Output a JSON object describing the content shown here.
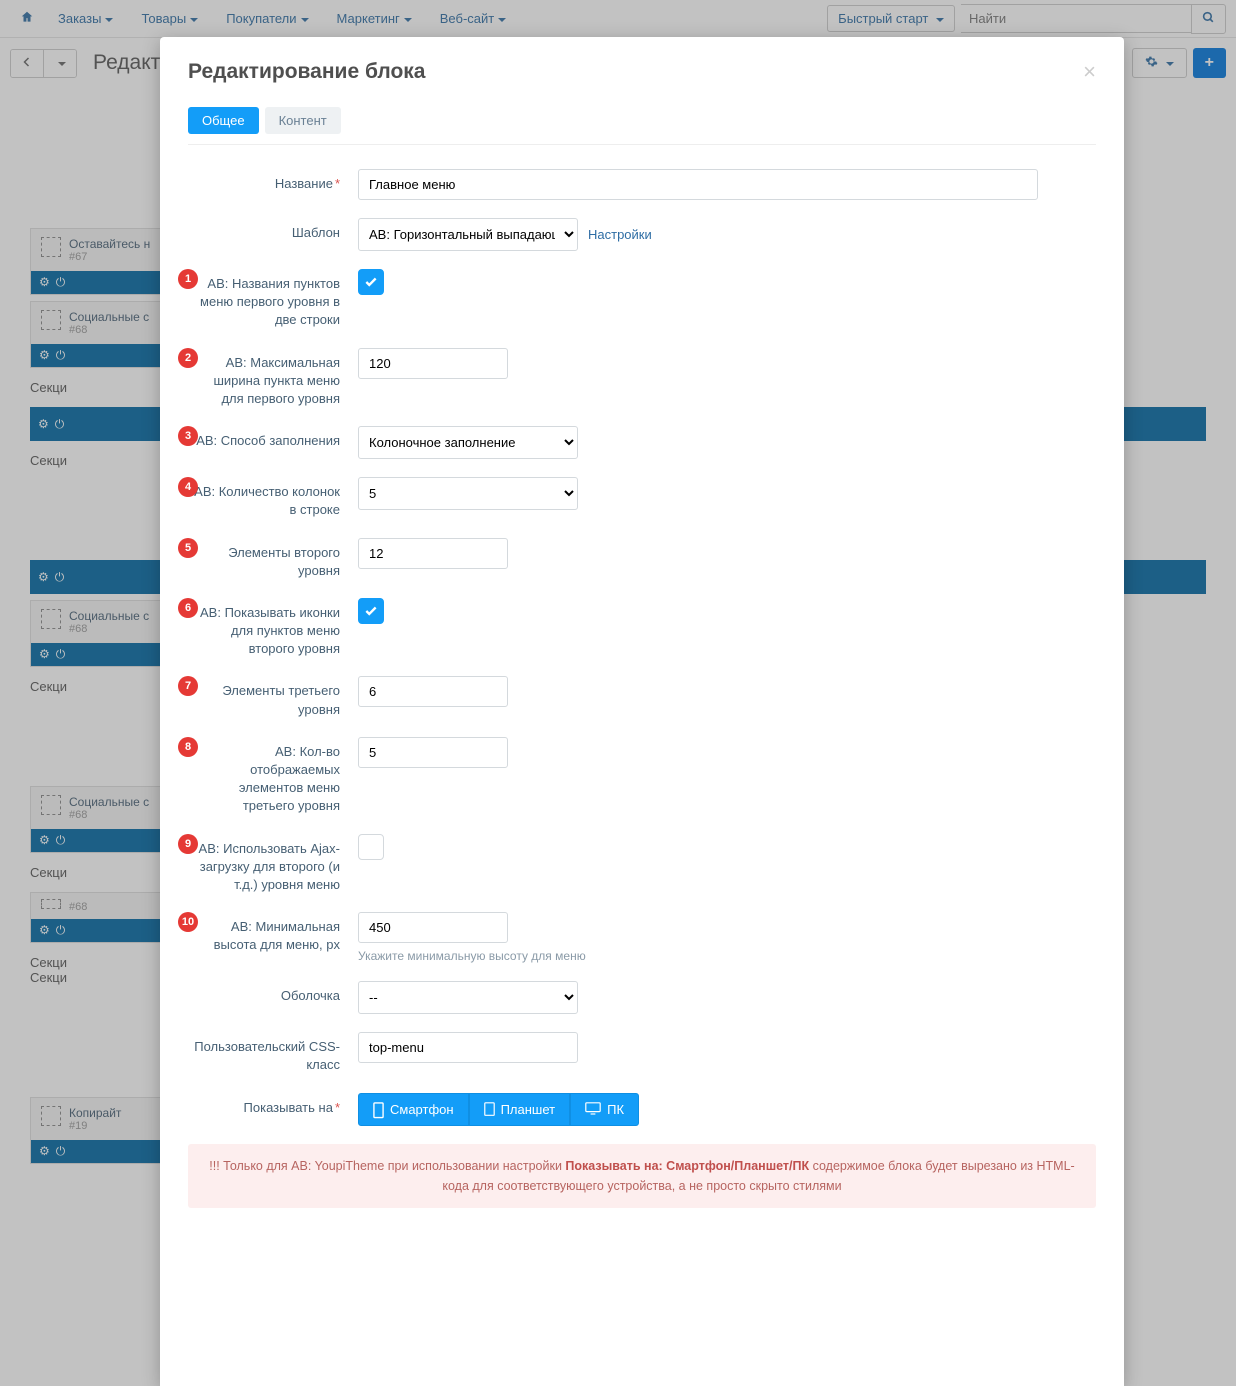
{
  "topnav": {
    "items": [
      "Заказы",
      "Товары",
      "Покупатели",
      "Маркетинг",
      "Веб-сайт"
    ],
    "quick_start": "Быстрый старт",
    "search_placeholder": "Найти"
  },
  "page": {
    "title": "Редакт",
    "back_icon": "‹"
  },
  "bg_blocks": [
    {
      "title": "Оставайтесь н",
      "id": "#67"
    },
    {
      "title": "Социальные с",
      "id": "#68"
    }
  ],
  "bg_sections": [
    "Секци",
    "Секци"
  ],
  "bg_blocks2": [
    {
      "title": "Социальные с",
      "id": "#68"
    },
    {
      "title": "Социальные с",
      "id": "#68"
    }
  ],
  "bg_blocks3": {
    "id": "#68"
  },
  "bg_blocks4": {
    "title": "Копирайт",
    "id": "#19"
  },
  "modal": {
    "title": "Редактирование блока",
    "tabs": {
      "general": "Общее",
      "content": "Контент"
    },
    "fields": {
      "name_label": "Название",
      "name_value": "Главное меню",
      "template_label": "Шаблон",
      "template_value": "AB: Горизонтальный выпадающий",
      "settings_link": "Настройки",
      "two_lines_label": "AB: Названия пунктов меню первого уровня в две строки",
      "max_width_label": "AB: Максимальная ширина пункта меню для первого уровня",
      "max_width_value": "120",
      "fill_label": "AB: Способ заполнения",
      "fill_value": "Колоночное заполнение",
      "cols_label": "AB: Количество колонок в строке",
      "cols_value": "5",
      "level2_label": "Элементы второго уровня",
      "level2_value": "12",
      "icons2_label": "AB: Показывать иконки для пунктов меню второго уровня",
      "level3_label": "Элементы третьего уровня",
      "level3_value": "6",
      "count3_label": "AB: Кол-во отображаемых элементов меню третьего уровня",
      "count3_value": "5",
      "ajax_label": "AB: Использовать Ajax-загрузку для второго (и т.д.) уровня меню",
      "minheight_label": "AB: Минимальная высота для меню, px",
      "minheight_value": "450",
      "minheight_help": "Укажите минимальную высоту для меню",
      "wrapper_label": "Оболочка",
      "wrapper_value": "--",
      "css_label": "Пользовательский CSS-класс",
      "css_value": "top-menu",
      "show_on_label": "Показывать на",
      "devices": {
        "phone": "Смартфон",
        "tablet": "Планшет",
        "pc": "ПК"
      }
    },
    "warning_pre": "!!! Только для AB: YoupiTheme при использовании настройки ",
    "warning_bold": "Показывать на: Смартфон/Планшет/ПК",
    "warning_post": " содержимое блока будет вырезано из HTML-кода для соответствующего устройства, а не просто скрыто стилями"
  }
}
